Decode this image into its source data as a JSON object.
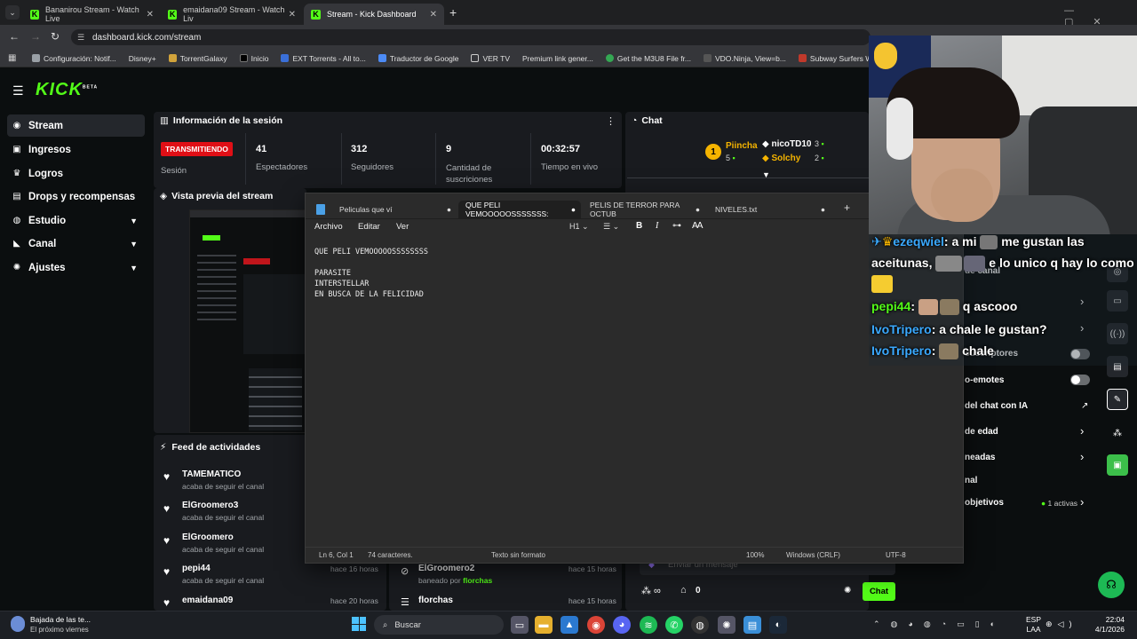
{
  "browser": {
    "tabs": [
      {
        "title": "Bananirou Stream - Watch Live"
      },
      {
        "title": "emaidana09 Stream - Watch Liv"
      },
      {
        "title": "Stream - Kick Dashboard"
      }
    ],
    "url": "dashboard.kick.com/stream",
    "bookmarks": [
      "Configuración: Notif...",
      "Disney+",
      "TorrentGalaxy",
      "Inicio",
      "EXT Torrents - All to...",
      "Traductor de Google",
      "VER TV",
      "Premium link gener...",
      "Get the M3U8 File fr...",
      "VDO.Ninja, View=b...",
      "Subway Surfers Web"
    ]
  },
  "kick": {
    "logo": "KICK",
    "logo_badge": "BETA",
    "sidebar": [
      {
        "label": "Stream",
        "icon": "stream-icon"
      },
      {
        "label": "Ingresos",
        "icon": "money-icon"
      },
      {
        "label": "Logros",
        "icon": "trophy-icon"
      },
      {
        "label": "Drops y recompensas",
        "icon": "gift-icon"
      },
      {
        "label": "Estudio",
        "icon": "studio-icon"
      },
      {
        "label": "Canal",
        "icon": "channel-icon"
      },
      {
        "label": "Ajustes",
        "icon": "gear-icon"
      }
    ],
    "session": {
      "title": "Información de la sesión",
      "live_badge": "TRANSMITIENDO",
      "sesion_label": "Sesión",
      "stats": [
        {
          "value": "41",
          "label": "Espectadores"
        },
        {
          "value": "312",
          "label": "Seguidores"
        },
        {
          "value": "9",
          "label": "Cantidad de suscriciones"
        },
        {
          "value": "00:32:57",
          "label": "Tiempo en vivo"
        }
      ]
    },
    "preview_title": "Vista previa del stream",
    "feed": {
      "title": "Feed de actividades",
      "items": [
        {
          "name": "TAMEMATICO",
          "sub": "acaba de seguir el canal",
          "time": ""
        },
        {
          "name": "ElGroomero3",
          "sub": "acaba de seguir el canal",
          "time": ""
        },
        {
          "name": "ElGroomero",
          "sub": "acaba de seguir el canal",
          "time": ""
        },
        {
          "name": "pepi44",
          "sub": "acaba de seguir el canal",
          "time": "hace 16 horas"
        },
        {
          "name": "emaidana09",
          "sub": "",
          "time": "hace 20 horas"
        }
      ],
      "mod_items": [
        {
          "name": "ElGroomero2",
          "sub_prefix": "baneado por",
          "sub_user": "florchas",
          "time": "hace 15 horas"
        },
        {
          "name": "florchas",
          "sub_prefix": "",
          "sub_user": "",
          "time": "hace 15 horas"
        }
      ]
    },
    "chat": {
      "title": "Chat",
      "top": [
        {
          "rank": "1",
          "name": "Piincha",
          "value": "5"
        },
        {
          "name": "nicoTD10",
          "value": "3"
        },
        {
          "name": "Solchy",
          "value": "2"
        }
      ],
      "input_placeholder": "Enviar un mensaje",
      "bottom_count": "0",
      "send_label": "Chat",
      "settings": [
        {
          "label": "de canal",
          "control": "chevron"
        },
        {
          "label": "",
          "control": "chevron"
        },
        {
          "label": "suscriptores",
          "control": "toggle"
        },
        {
          "label": "o-emotes",
          "control": "toggle"
        },
        {
          "label": "del chat con IA",
          "control": "link"
        },
        {
          "label": "de edad",
          "control": "chevron"
        },
        {
          "label": "neadas",
          "control": "chevron"
        },
        {
          "label": "nal",
          "control": "none"
        },
        {
          "label": "objetivos",
          "control": "chevron",
          "badge": "1 activas"
        }
      ]
    }
  },
  "notepad": {
    "tabs": [
      "Peliculas que ví",
      "QUE PELI VEMOOOOOSSSSSSS:",
      "PELIS DE TERROR PARA OCTUB",
      "NIVELES.txt"
    ],
    "menu": [
      "Archivo",
      "Editar",
      "Ver"
    ],
    "heading_control": "H1",
    "content": "QUE PELI VEMOOOOOSSSSSSSS\n\nPARASITE\nINTERSTELLAR\nEN BUSCA DE LA FELICIDAD",
    "status": {
      "position": "Ln 6, Col 1",
      "chars": "74 caracteres.",
      "format": "Texto sin formato",
      "zoom": "100%",
      "eol": "Windows (CRLF)",
      "encoding": "UTF-8"
    }
  },
  "overlay_chat": [
    {
      "user": "ezeqwiel",
      "text": ": a mi ",
      "text2": " me gustan las"
    },
    {
      "user": "",
      "text": "aceitunas, ",
      "text2": " e lo unico q hay lo como"
    },
    {
      "user": "pepi44",
      "text": ": ",
      "text2": " q ascooo"
    },
    {
      "user": "IvoTripero",
      "text": ": a chale le gustan?",
      "text2": ""
    },
    {
      "user": "IvoTripero",
      "text": ": ",
      "text2": " chale"
    }
  ],
  "taskbar": {
    "notification_title": "Bajada de las te...",
    "notification_sub": "El próximo viernes",
    "search": "Buscar",
    "lang": "ESP",
    "lang2": "LAA",
    "time": "22:04",
    "date": "4/1/2026"
  }
}
